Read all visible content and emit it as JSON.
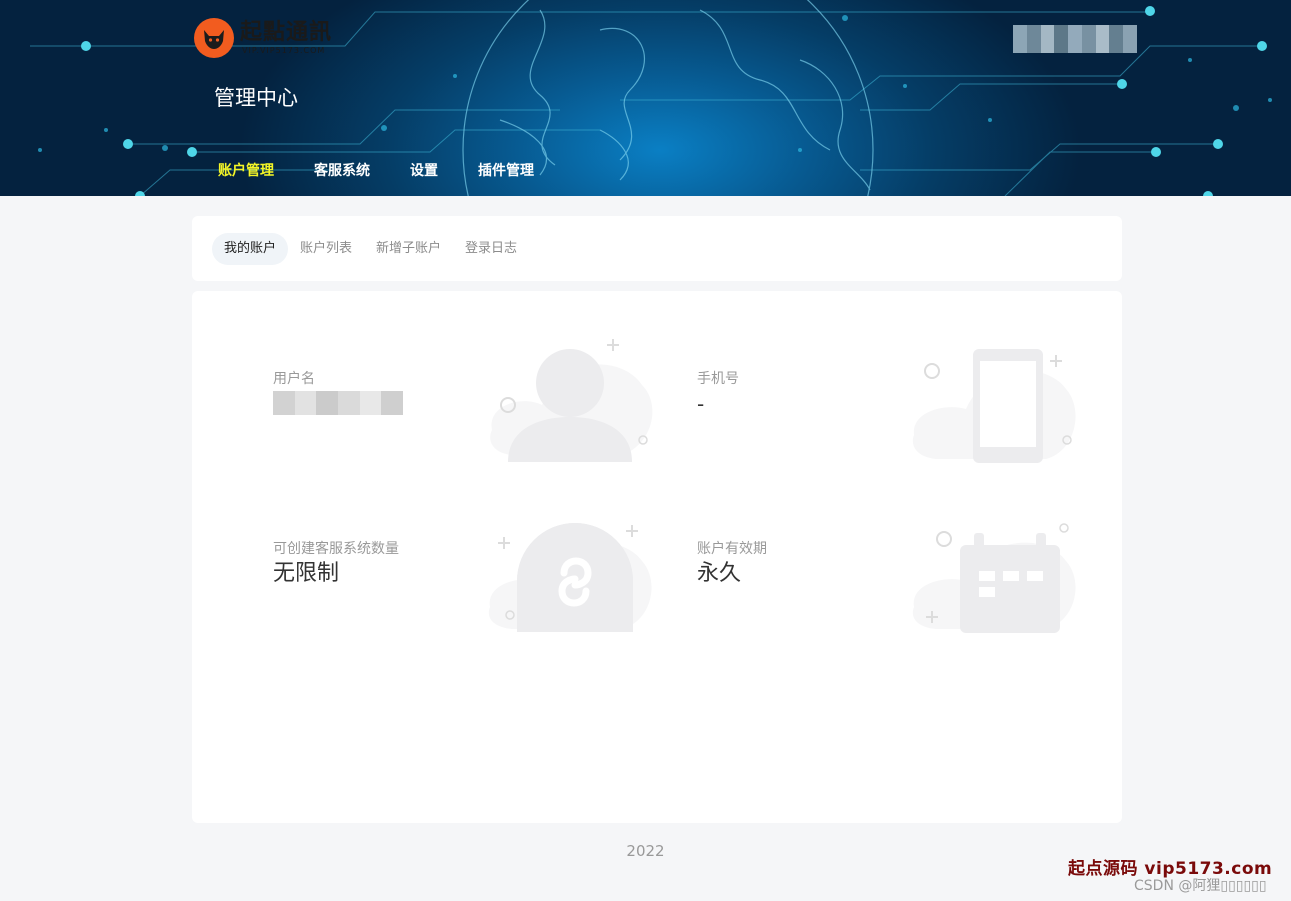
{
  "logo": {
    "title": "起點通訊",
    "subtitle": "VIP.VIP5173.COM"
  },
  "header": {
    "title": "管理中心"
  },
  "nav": [
    {
      "label": "账户管理",
      "active": true
    },
    {
      "label": "客服系统",
      "active": false
    },
    {
      "label": "设置",
      "active": false
    },
    {
      "label": "插件管理",
      "active": false
    }
  ],
  "tabs": [
    {
      "label": "我的账户",
      "active": true
    },
    {
      "label": "账户列表",
      "active": false
    },
    {
      "label": "新增子账户",
      "active": false
    },
    {
      "label": "登录日志",
      "active": false
    }
  ],
  "account": {
    "username_label": "用户名",
    "phone_label": "手机号",
    "phone_value": "-",
    "quota_label": "可创建客服系统数量",
    "quota_value": "无限制",
    "validity_label": "账户有效期",
    "validity_value": "永久"
  },
  "icons": [
    "user-icon",
    "phone-icon",
    "mini-program-icon",
    "calendar-icon",
    "fox-logo-icon"
  ],
  "footer": {
    "year": "2022"
  },
  "watermark": {
    "brand": "起点源码 vip5173.com",
    "csdn": "CSDN @阿狸▯▯▯▯▯▯"
  },
  "colors": {
    "active_nav": "#f3f527",
    "banner": "#053d66",
    "logo_badge": "#f25c1f"
  }
}
